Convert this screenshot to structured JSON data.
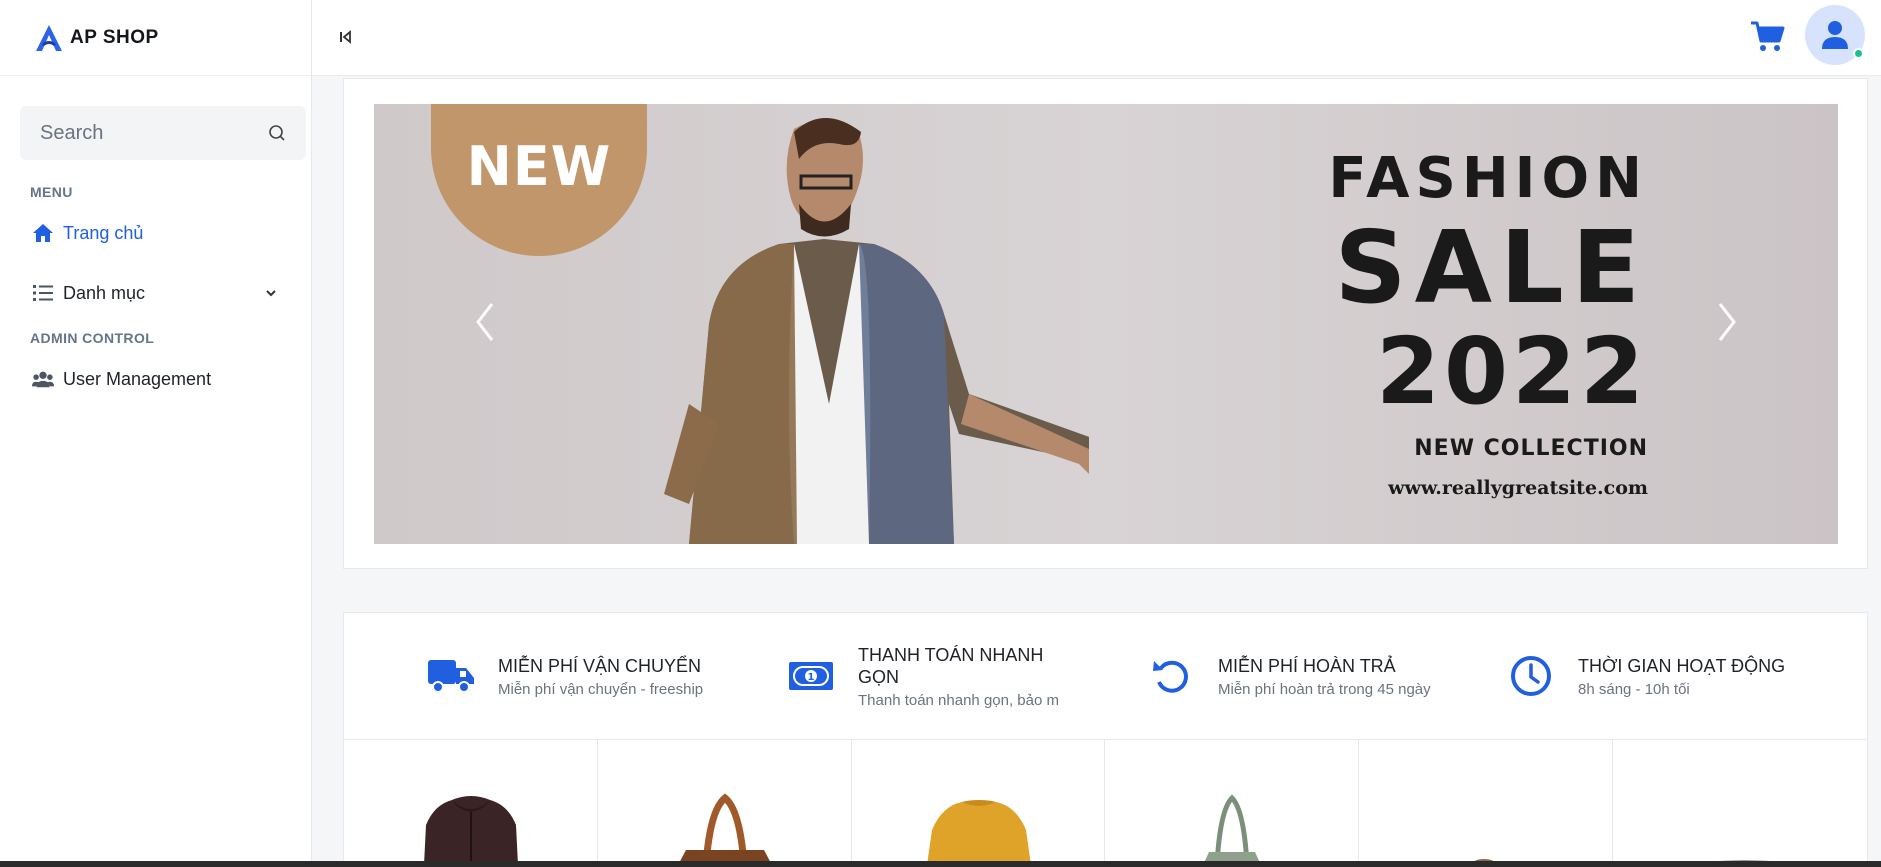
{
  "brand": {
    "name": "AP SHOP",
    "logo_icon": "logo-a-icon"
  },
  "search": {
    "placeholder": "Search"
  },
  "sidebar": {
    "menu_label": "MENU",
    "items": [
      {
        "label": "Trang chủ",
        "icon": "home-icon",
        "active": true
      },
      {
        "label": "Danh mục",
        "icon": "list-icon",
        "expandable": true
      }
    ],
    "admin_label": "ADMIN CONTROL",
    "admin_items": [
      {
        "label": "User Management",
        "icon": "users-icon"
      }
    ]
  },
  "header": {
    "collapse_icon": "collapse-sidebar-icon",
    "cart_icon": "cart-icon",
    "avatar_icon": "user-icon",
    "status": "online"
  },
  "banner": {
    "badge": "NEW",
    "line1": "FASHION",
    "line2": "SALE",
    "line3": "2022",
    "line4": "NEW COLLECTION",
    "line5": "www.reallygreatsite.com"
  },
  "features": [
    {
      "title": "MIỄN PHÍ VẬN CHUYỂN",
      "subtitle": "Miễn phí vận chuyển - freeship",
      "icon": "truck-icon"
    },
    {
      "title": "THANH TOÁN NHANH GỌN",
      "subtitle": "Thanh toán nhanh gọn, bảo m",
      "icon": "money-icon"
    },
    {
      "title": "MIỄN PHÍ HOÀN TRẢ",
      "subtitle": "Miễn phí hoàn trả trong 45 ngày",
      "icon": "return-icon"
    },
    {
      "title": "THỜI GIAN HOẠT ĐỘNG",
      "subtitle": "8h sáng - 10h tối",
      "icon": "clock-icon"
    }
  ],
  "products": [
    {
      "icon": "hoodie-image"
    },
    {
      "icon": "bag-image"
    },
    {
      "icon": "sweater-image"
    },
    {
      "icon": "tote-bag-image"
    },
    {
      "icon": "product-image"
    },
    {
      "icon": "product-image"
    }
  ],
  "colors": {
    "accent": "#1f5fe0",
    "badge": "#c1966a",
    "online": "#14c38e"
  }
}
